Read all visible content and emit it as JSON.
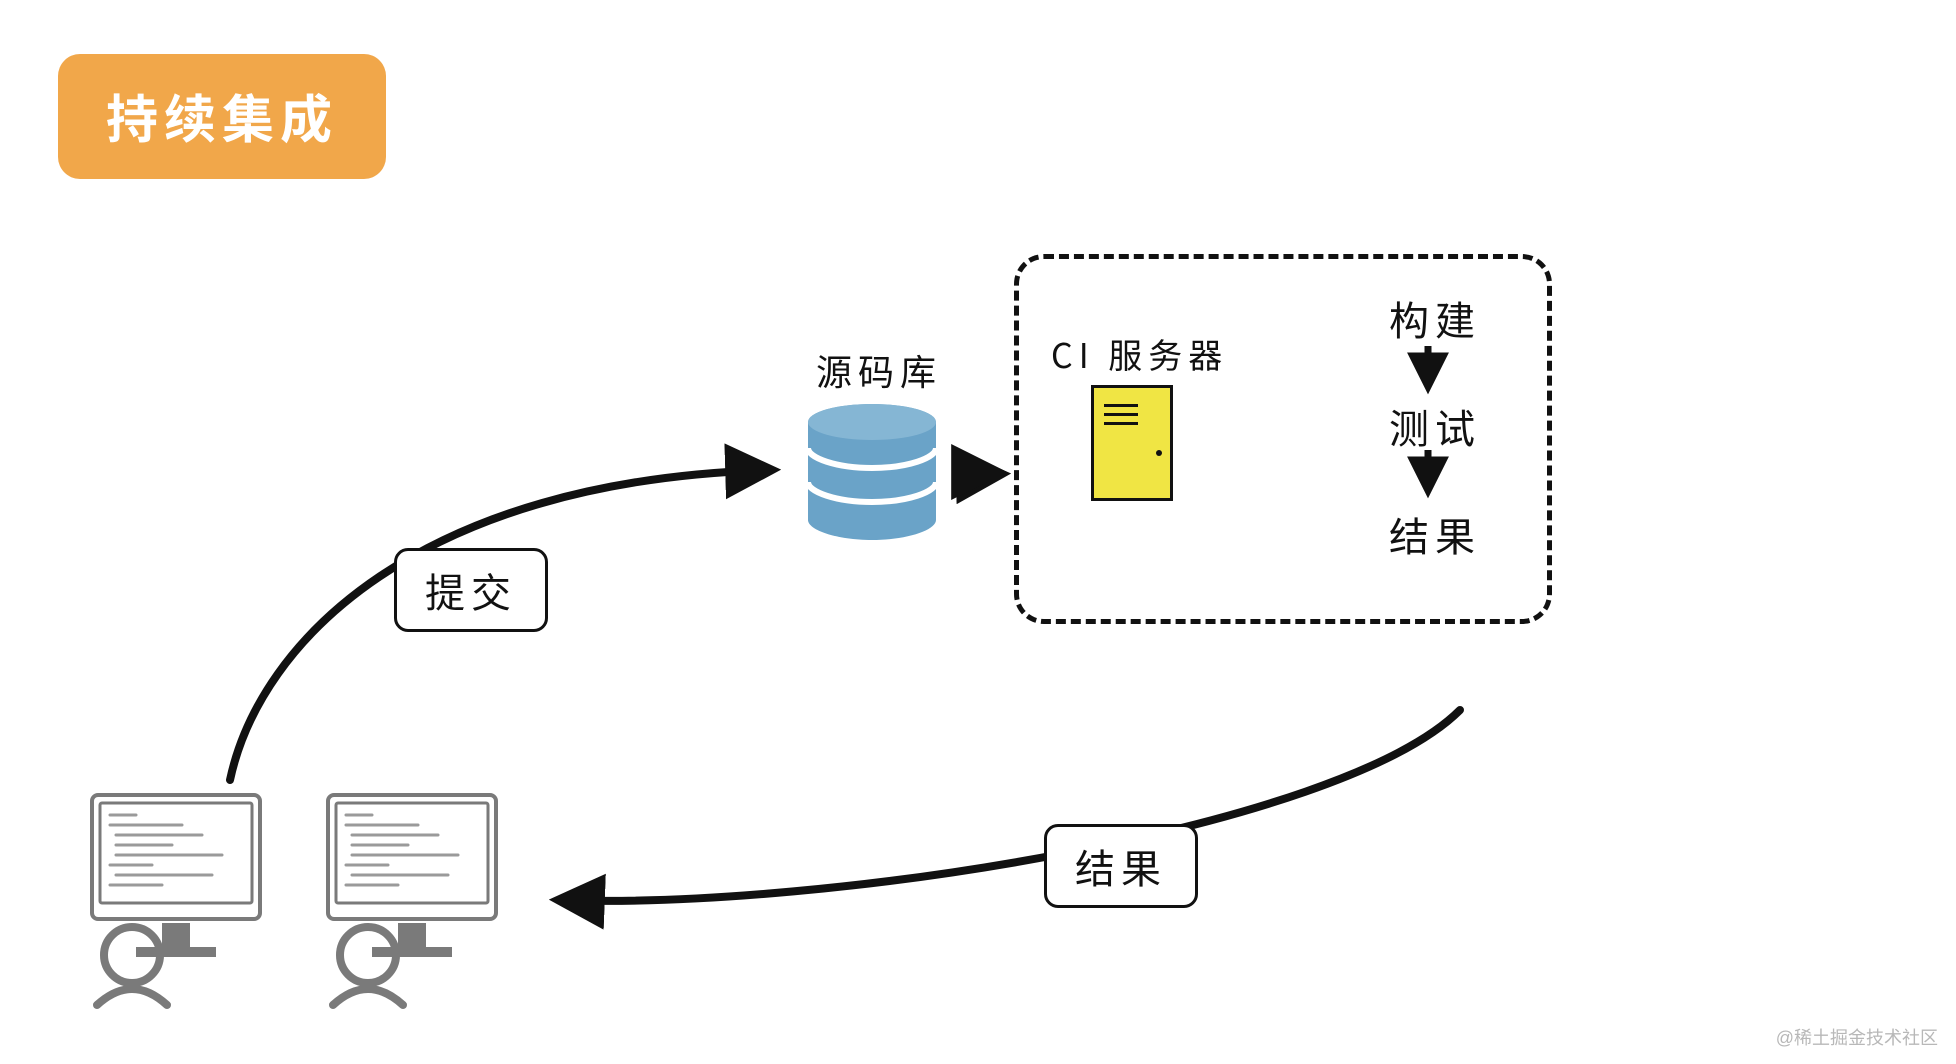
{
  "title": "持续集成",
  "labels": {
    "commit": "提交",
    "result_feedback": "结果",
    "repo": "源码库",
    "ci_server": "CI 服务器"
  },
  "pipeline": {
    "step1": "构建",
    "step2": "测试",
    "step3": "结果"
  },
  "watermark": "@稀土掘金技术社区"
}
